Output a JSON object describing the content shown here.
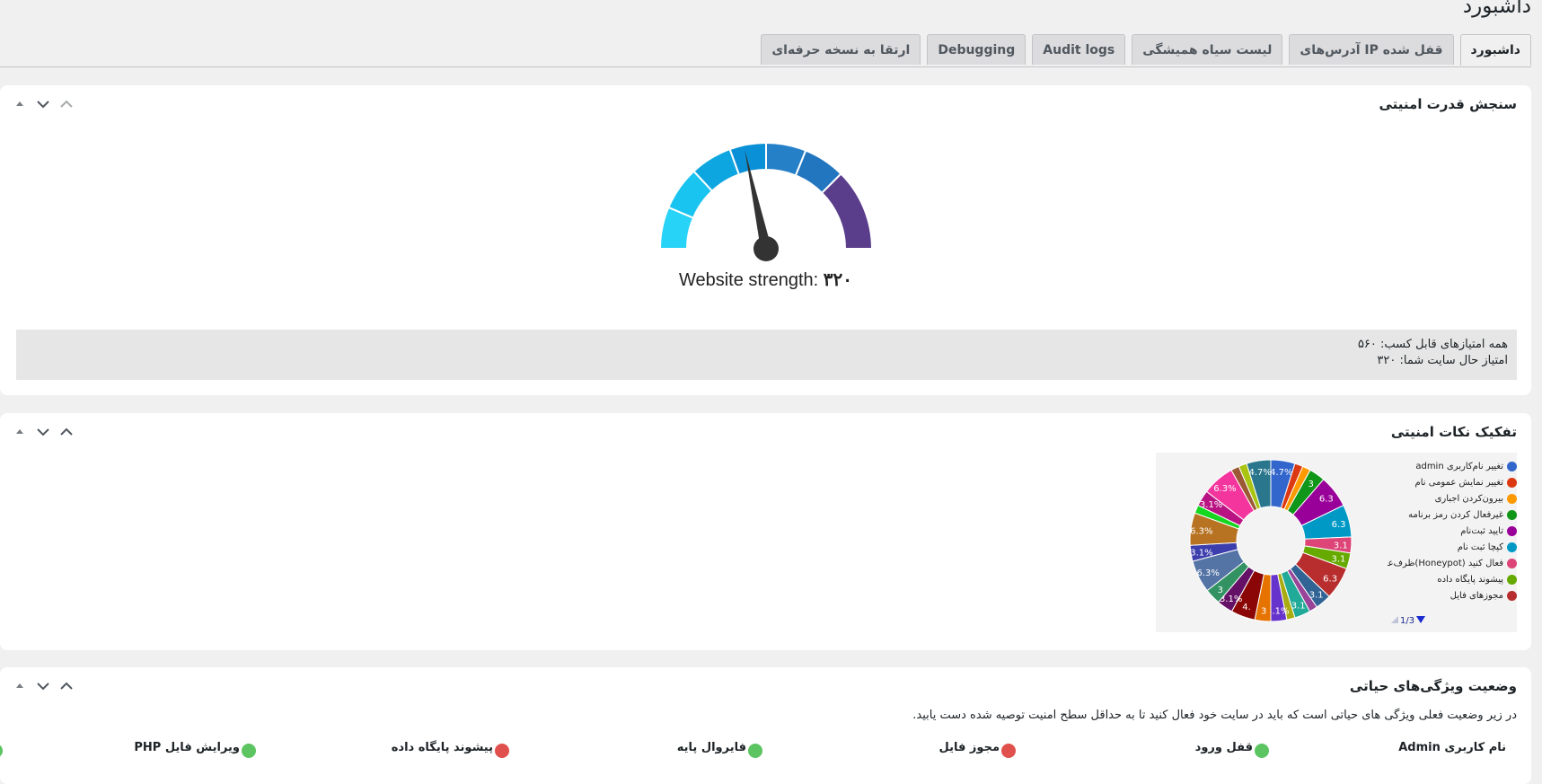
{
  "page_title": "داشبورد",
  "tabs": [
    {
      "label": "داشبورد",
      "active": true
    },
    {
      "label": "آدرس‌های IP قفل شده",
      "active": false
    },
    {
      "label": "لیست سیاه همیشگی",
      "active": false
    },
    {
      "label": "Audit logs",
      "active": false
    },
    {
      "label": "Debugging",
      "active": false
    },
    {
      "label": "ارتقا به نسخه حرفه‌ای",
      "active": false
    }
  ],
  "strength_panel": {
    "title": "سنجش قدرت امنیتی",
    "gauge": {
      "label": "Website strength:",
      "value_text": "۳۲۰",
      "score": 320,
      "max": 560,
      "segment_colors": [
        "#27d3f7",
        "#19c4f1",
        "#0ea6e0",
        "#0a90d6",
        "#2680c8",
        "#2276c0",
        "#5a3e8c"
      ]
    },
    "max_points_text": "همه امتیازهای قابل کسب: ۵۶۰",
    "current_points_text": "امتیاز حال سایت شما: ۳۲۰"
  },
  "breakdown_panel": {
    "title": "تفکیک نکات امنیتی",
    "legend": [
      {
        "label": "تغییر نام‌کاربری admin",
        "color": "#3366cc"
      },
      {
        "label": "تغییر نمایش عمومی نام",
        "color": "#dc3912"
      },
      {
        "label": "بیرون‌کردن اجباری",
        "color": "#ff9900"
      },
      {
        "label": "غیرفعال کردن رمز برنامه",
        "color": "#109618"
      },
      {
        "label": "تایید ثبت‌نام",
        "color": "#990099"
      },
      {
        "label": "کپچا ثبت نام",
        "color": "#0099c6"
      },
      {
        "label": "فعال کنید (Honeypot)ظرف‌عسل",
        "color": "#dd4477"
      },
      {
        "label": "پیشوند پایگاه داده",
        "color": "#66aa00"
      },
      {
        "label": "مجوزهای فایل",
        "color": "#b82e2e"
      }
    ],
    "pager": "1/3",
    "chart_data": {
      "type": "pie",
      "donut": true,
      "slices": [
        {
          "value": 4.7,
          "label": "4.7%",
          "color": "#3366cc"
        },
        {
          "value": 1.6,
          "label": "",
          "color": "#dc3912"
        },
        {
          "value": 1.6,
          "label": "",
          "color": "#ff9900"
        },
        {
          "value": 3.1,
          "label": "3",
          "color": "#109618"
        },
        {
          "value": 6.3,
          "label": "6.3",
          "color": "#990099"
        },
        {
          "value": 6.3,
          "label": "6.3",
          "color": "#0099c6"
        },
        {
          "value": 3.1,
          "label": "3.1",
          "color": "#dd4477"
        },
        {
          "value": 3.1,
          "label": "3.1",
          "color": "#66aa00"
        },
        {
          "value": 6.3,
          "label": "6.3",
          "color": "#b82e2e"
        },
        {
          "value": 3.1,
          "label": "3.1",
          "color": "#316395"
        },
        {
          "value": 1.6,
          "label": "",
          "color": "#994499"
        },
        {
          "value": 3.1,
          "label": "3.1",
          "color": "#22aa99"
        },
        {
          "value": 1.6,
          "label": "",
          "color": "#aaaa11"
        },
        {
          "value": 3.1,
          "label": "3.1%",
          "color": "#6633cc"
        },
        {
          "value": 3.1,
          "label": "3",
          "color": "#e67300"
        },
        {
          "value": 4.7,
          "label": "4.",
          "color": "#8b0707"
        },
        {
          "value": 3.1,
          "label": "3.1%",
          "color": "#651067"
        },
        {
          "value": 3.1,
          "label": "3",
          "color": "#329262"
        },
        {
          "value": 6.3,
          "label": "6.3%",
          "color": "#5574a6"
        },
        {
          "value": 3.1,
          "label": "3.1%",
          "color": "#3b3eac"
        },
        {
          "value": 6.3,
          "label": "6.3%",
          "color": "#b77322"
        },
        {
          "value": 1.6,
          "label": "",
          "color": "#16d620"
        },
        {
          "value": 3.1,
          "label": "3.1%",
          "color": "#b91383"
        },
        {
          "value": 6.3,
          "label": "6.3%",
          "color": "#f4359e"
        },
        {
          "value": 1.6,
          "label": "",
          "color": "#9c5935"
        },
        {
          "value": 1.6,
          "label": "",
          "color": "#a9c413"
        },
        {
          "value": 4.7,
          "label": "4.7%",
          "color": "#2a778d"
        }
      ]
    }
  },
  "vitals_panel": {
    "title": "وضعیت ویژگی‌های حیاتی",
    "description": "در زیر وضعیت فعلی ویژگی های حیاتی است که باید در سایت خود فعال کنید تا به حداقل سطح امنیت توصیه شده دست یابید.",
    "items": [
      {
        "label": "نام کاربری Admin",
        "status_color": "#5cc461"
      },
      {
        "label": "قفل ورود",
        "status_color": "#e0504c"
      },
      {
        "label": "مجوز فایل",
        "status_color": "#5cc461"
      },
      {
        "label": "فایروال پایه",
        "status_color": "#e0504c"
      },
      {
        "label": "پیشوند پایگاه داده",
        "status_color": "#5cc461"
      },
      {
        "label": "ویرایش فایل PHP",
        "status_color": "#5cc461"
      }
    ]
  }
}
